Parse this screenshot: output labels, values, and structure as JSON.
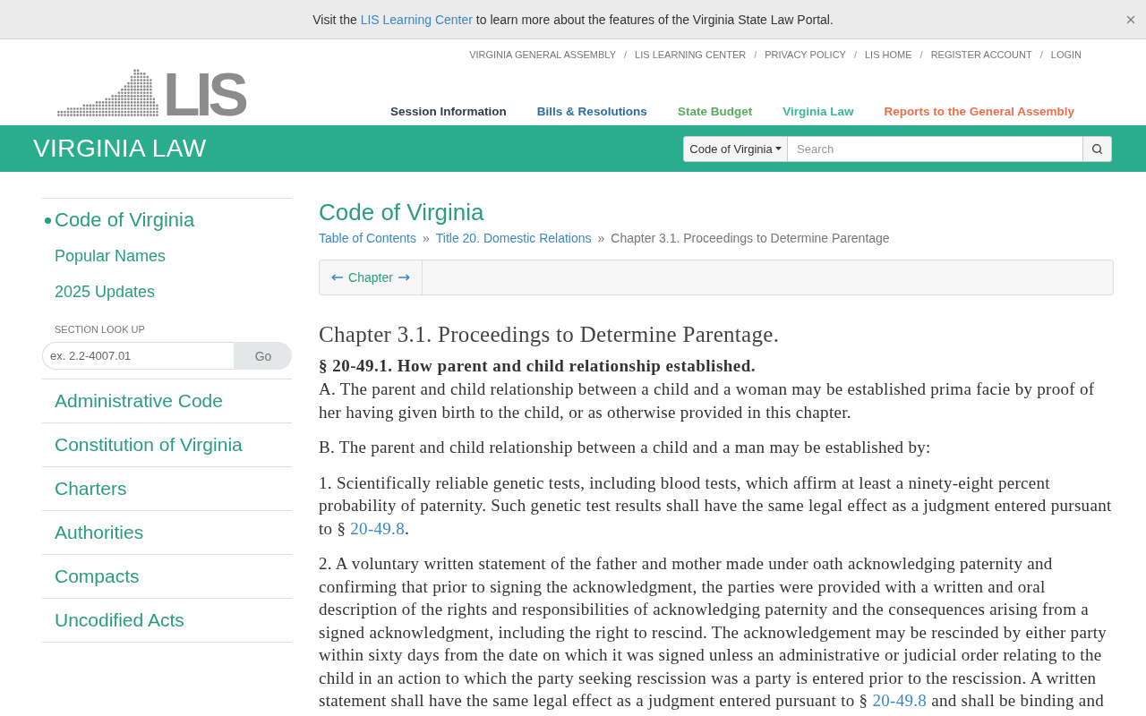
{
  "banner": {
    "parts": [
      {
        "kind": "text",
        "text": "Visit the "
      },
      {
        "kind": "link",
        "text": "LIS Learning Center"
      },
      {
        "kind": "text",
        "text": " to learn more about the features of the Virginia State Law Portal."
      }
    ]
  },
  "header": {
    "logo_text": "LIS",
    "utility_links": [
      {
        "kind": "link",
        "label": "VIRGINIA GENERAL ASSEMBLY"
      },
      {
        "kind": "separator",
        "label": "/"
      },
      {
        "kind": "link",
        "label": "LIS LEARNING CENTER"
      },
      {
        "kind": "separator",
        "label": "/"
      },
      {
        "kind": "link",
        "label": "PRIVACY POLICY"
      },
      {
        "kind": "separator",
        "label": "/"
      },
      {
        "kind": "link",
        "label": "LIS HOME"
      },
      {
        "kind": "separator",
        "label": "/"
      },
      {
        "kind": "link",
        "label": "REGISTER ACCOUNT"
      },
      {
        "kind": "separator",
        "label": "/"
      },
      {
        "kind": "link",
        "label": "LOGIN"
      }
    ],
    "nav": [
      {
        "label": "Session Information",
        "color": "#2f3d4d"
      },
      {
        "label": "Bills & Resolutions",
        "color": "#2e6ca4"
      },
      {
        "label": "State Budget",
        "color": "#5aac5e"
      },
      {
        "label": "Virginia Law",
        "color": "#3bb896"
      },
      {
        "label": "Reports to the General Assembly",
        "color": "#ea6f4c"
      }
    ]
  },
  "site_bar": {
    "title": "VIRGINIA LAW",
    "search": {
      "scope": "Code of Virginia",
      "placeholder": "Search"
    }
  },
  "sidebar": {
    "current": {
      "label": "Code of Virginia",
      "selected": true,
      "links": [
        {
          "label": "Popular Names"
        },
        {
          "label": "2025 Updates"
        }
      ]
    },
    "section_lookup": {
      "label": "SECTION LOOK UP",
      "placeholder": "ex. 2.2-4007.01",
      "button": "Go"
    },
    "items": [
      {
        "label": "Administrative Code",
        "selected": false
      },
      {
        "label": "Constitution of Virginia",
        "selected": false
      },
      {
        "label": "Charters",
        "selected": false
      },
      {
        "label": "Authorities",
        "selected": false
      },
      {
        "label": "Compacts",
        "selected": false
      },
      {
        "label": "Uncodified Acts",
        "selected": false
      }
    ]
  },
  "content": {
    "title": "Code of Virginia",
    "breadcrumb": [
      {
        "kind": "link",
        "label": "Table of Contents"
      },
      {
        "kind": "separator",
        "label": "»"
      },
      {
        "kind": "link",
        "label": "Title 20. Domestic Relations"
      },
      {
        "kind": "separator",
        "label": "»"
      },
      {
        "kind": "current",
        "label": "Chapter 3.1. Proceedings to Determine Parentage"
      }
    ],
    "pager": {
      "label": "Chapter"
    },
    "chapter_title": "Chapter 3.1. Proceedings to Determine Parentage.",
    "section_heading": "§ 20-49.1. How parent and child relationship established.",
    "paragraphs": [
      {
        "parts": [
          {
            "kind": "text",
            "text": "A. The parent and child relationship between a child and a woman may be established prima facie by proof of her having given birth to the child, or as otherwise provided in this chapter."
          }
        ]
      },
      {
        "parts": [
          {
            "kind": "text",
            "text": "B. The parent and child relationship between a child and a man may be established by:"
          }
        ]
      },
      {
        "parts": [
          {
            "kind": "text",
            "text": "1. Scientifically reliable genetic tests, including blood tests, which affirm at least a ninety-eight percent probability of paternity. Such genetic test results shall have the same legal effect as a judgment entered pursuant to § "
          },
          {
            "kind": "link",
            "text": "20-49.8"
          },
          {
            "kind": "text",
            "text": "."
          }
        ]
      },
      {
        "parts": [
          {
            "kind": "text",
            "text": "2. A voluntary written statement of the father and mother made under oath acknowledging paternity and confirming that prior to signing the acknowledgment, the parties were provided with a written and oral description of the rights and responsibilities of acknowledging paternity and the consequences arising from a signed acknowledgment, including the right to rescind. The acknowledgement may be rescinded by either party within sixty days from the date on which it was signed unless an administrative or judicial order relating to the child in an action to which the party seeking rescission was a party is entered prior to the rescission. A written statement shall have the same legal effect as a judgment entered pursuant to § "
          },
          {
            "kind": "link",
            "text": "20-49.8"
          },
          {
            "kind": "text",
            "text": " and shall be binding and"
          }
        ]
      }
    ]
  }
}
